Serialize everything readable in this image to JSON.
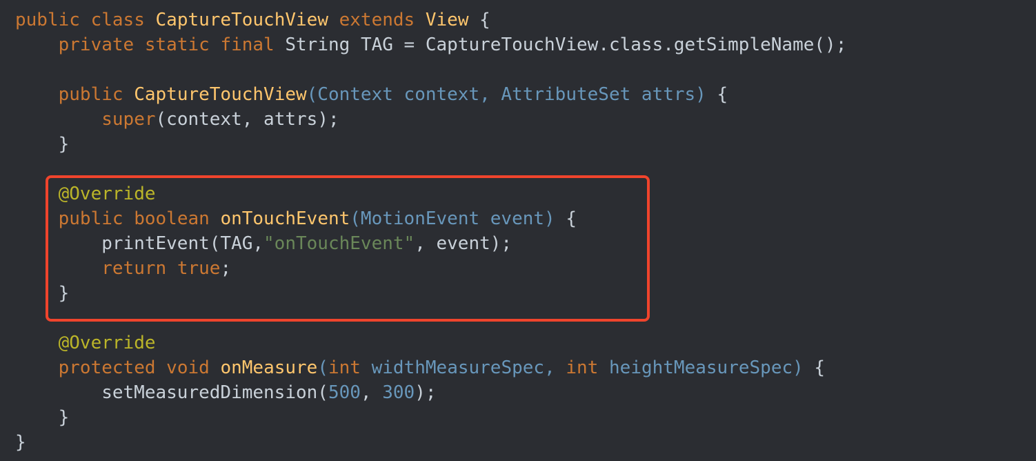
{
  "code": {
    "l1": {
      "t1": "public",
      "t2": " ",
      "t3": "class",
      "t4": " ",
      "t5": "CaptureTouchView",
      "t6": " ",
      "t7": "extends",
      "t8": " ",
      "t9": "View",
      "t10": " {"
    },
    "l2": {
      "t1": "    ",
      "t2": "private",
      "t3": " ",
      "t4": "static",
      "t5": " ",
      "t6": "final",
      "t7": " String TAG = CaptureTouchView.class.getSimpleName();"
    },
    "l4": {
      "t1": "    ",
      "t2": "public",
      "t3": " ",
      "t4": "CaptureTouchView",
      "t5": "(Context context, AttributeSet attrs)",
      "t6": " {"
    },
    "l5": {
      "t1": "        ",
      "t2": "super",
      "t3": "(context, attrs);"
    },
    "l6": {
      "t1": "    }"
    },
    "l8": {
      "t1": "    ",
      "t2": "@Override"
    },
    "l9": {
      "t1": "    ",
      "t2": "public",
      "t3": " ",
      "t4": "boolean",
      "t5": " ",
      "t6": "onTouchEvent",
      "t7": "(MotionEvent event)",
      "t8": " {"
    },
    "l10": {
      "t1": "        printEvent(TAG,",
      "t2": "\"onTouchEvent\"",
      "t3": ", event);"
    },
    "l11": {
      "t1": "        ",
      "t2": "return",
      "t3": " ",
      "t4": "true",
      "t5": ";"
    },
    "l12": {
      "t1": "    }"
    },
    "l14": {
      "t1": "    ",
      "t2": "@Override"
    },
    "l15": {
      "t1": "    ",
      "t2": "protected",
      "t3": " ",
      "t4": "void",
      "t5": " ",
      "t6": "onMeasure",
      "t7": "(",
      "t8": "int",
      "t9": " widthMeasureSpec, ",
      "t10": "int",
      "t11": " heightMeasureSpec)",
      "t12": " {"
    },
    "l16": {
      "t1": "        setMeasuredDimension(",
      "t2": "500",
      "t3": ", ",
      "t4": "300",
      "t5": ");"
    },
    "l17": {
      "t1": "    }"
    },
    "l18": {
      "t1": "}"
    }
  },
  "colors": {
    "background": "#2b2d32",
    "keyword": "#cc7832",
    "method": "#ffc66d",
    "parameter": "#6897bb",
    "annotation": "#bbb529",
    "string": "#6a8759",
    "plain": "#c9d1d9",
    "highlight_border": "#f0442c"
  }
}
